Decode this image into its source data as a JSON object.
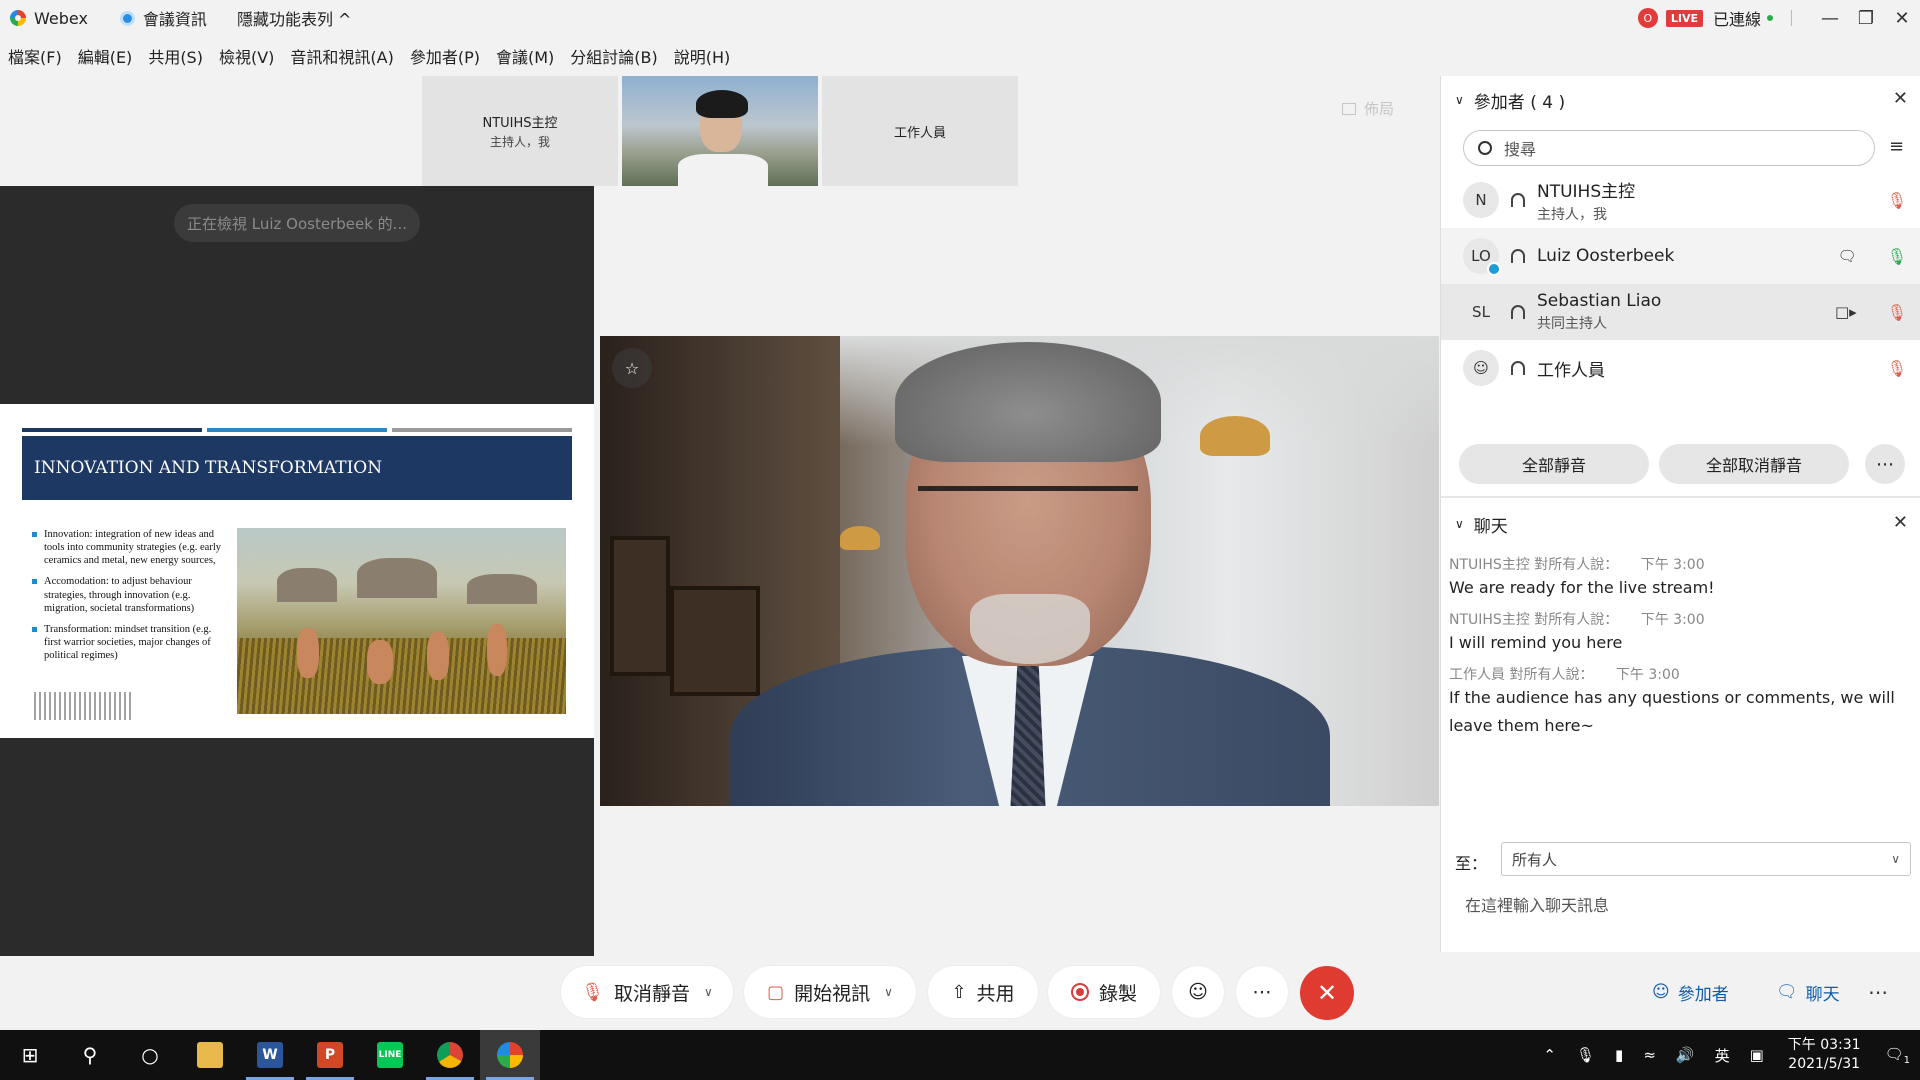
{
  "titlebar": {
    "app_name": "Webex",
    "meeting_info": "會議資訊",
    "hide_menu": "隱藏功能表列 ^",
    "rec_indicator": "O",
    "live_badge": "LIVE",
    "connection": "已連線"
  },
  "menu": [
    "檔案(F)",
    "編輯(E)",
    "共用(S)",
    "檢視(V)",
    "音訊和視訊(A)",
    "參加者(P)",
    "會議(M)",
    "分組討論(B)",
    "說明(H)"
  ],
  "thumbnails": {
    "host_name": "NTUIHS主控",
    "host_role": "主持人，我",
    "staff_name": "工作人員"
  },
  "layout_button": "佈局",
  "share": {
    "viewing_pill": "正在檢視 Luiz Oosterbeek 的...",
    "slide_title": "INNOVATION AND TRANSFORMATION",
    "bullets": [
      "Innovation: integration of new ideas and tools into community strategies (e.g. early ceramics and metal, new energy sources,",
      "Accomodation: to adjust behaviour strategies, through innovation (e.g. migration, societal transformations)",
      "Transformation: mindset transition (e.g. first warrior societies, major changes of political regimes)"
    ]
  },
  "participants_panel": {
    "header": "參加者 ( 4 )",
    "search_placeholder": "搜尋",
    "participants": [
      {
        "initials": "N",
        "name": "NTUIHS主控",
        "role": "主持人，我"
      },
      {
        "initials": "LO",
        "name": "Luiz Oosterbeek",
        "role": ""
      },
      {
        "initials": "SL",
        "name": "Sebastian Liao",
        "role": "共同主持人"
      },
      {
        "initials": "",
        "name": "工作人員",
        "role": ""
      }
    ],
    "mute_all": "全部靜音",
    "unmute_all": "全部取消靜音"
  },
  "chat_panel": {
    "header": "聊天",
    "messages": [
      {
        "sender": "NTUIHS主控 對所有人說：",
        "time": "下午 3:00",
        "text": "We are ready for the live stream!"
      },
      {
        "sender": "NTUIHS主控 對所有人說：",
        "time": "下午 3:00",
        "text": "I will remind you here"
      },
      {
        "sender": "工作人員 對所有人說：",
        "time": "下午 3:00",
        "text": "If the audience has any questions or comments, we will leave them here~"
      }
    ],
    "to_label": "至：",
    "to_value": "所有人",
    "input_placeholder": "在這裡輸入聊天訊息"
  },
  "controls": {
    "unmute": "取消靜音",
    "start_video": "開始視訊",
    "share": "共用",
    "record": "錄製",
    "participants": "參加者",
    "chat": "聊天"
  },
  "taskbar": {
    "ime": "英",
    "time": "下午 03:31",
    "date": "2021/5/31",
    "notifications": "1"
  },
  "colors": {
    "accent_blue": "#0b5cad",
    "leave_red": "#e03b31",
    "muted_red": "#e05b4b",
    "active_green": "#2bab4a",
    "slide_navy": "#1e3864"
  }
}
